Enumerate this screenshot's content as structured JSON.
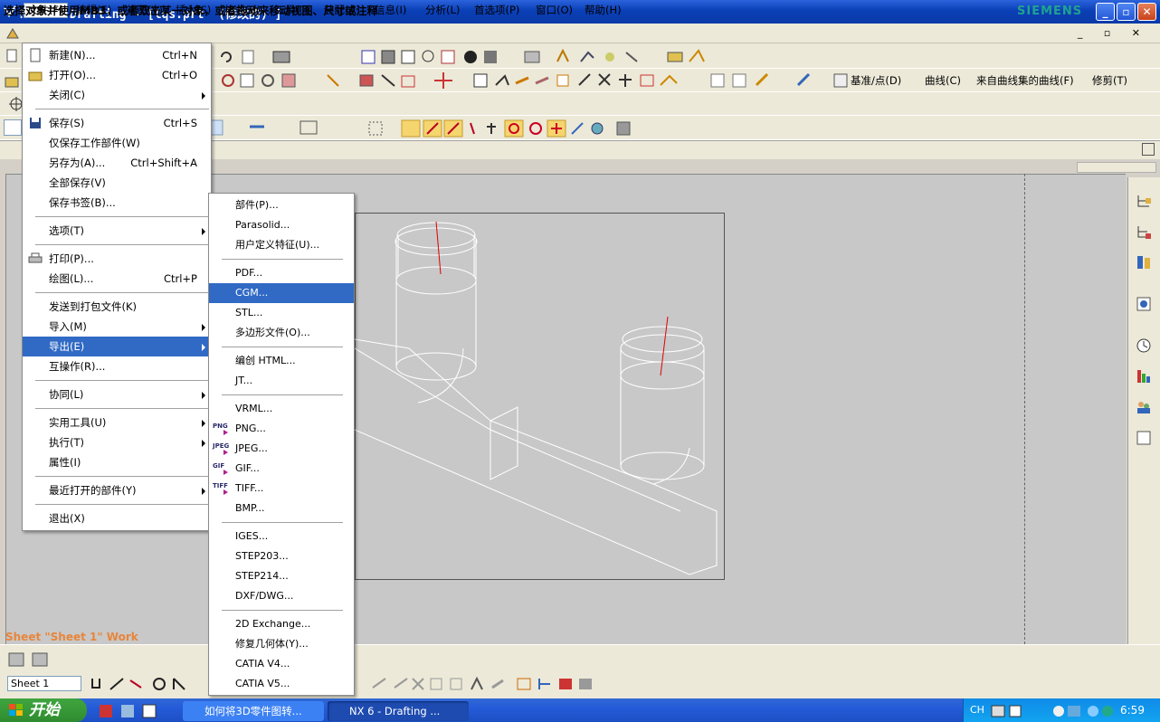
{
  "window": {
    "title": "NX 6 - Drafting - [lqs.prt  (修改的) ]",
    "brand": "SIEMENS"
  },
  "menubar": [
    "文件(F)",
    "编辑(E)",
    "视图(V)",
    "插入(S)",
    "格式(R)",
    "工具(T)",
    "装配(A)",
    "信息(I)",
    "分析(L)",
    "首选项(P)",
    "窗口(O)",
    "帮助(H)"
  ],
  "toolbar3": {
    "snap_label": "基准/点(D)",
    "curve_label": "曲线(C)",
    "curve_collection": "来自曲线集的曲线(F)",
    "trim_label": "修剪(T)"
  },
  "cue_line": "选择对象并使用MB3，或者双击某一对象，或者拖动来移动视图、尺寸或注释",
  "sheet_label": "Sheet \"Sheet 1\" Work",
  "sheet_select": "Sheet 1",
  "file_menu": [
    {
      "label": "新建(N)...",
      "shortcut": "Ctrl+N",
      "icon": "new-file-icon"
    },
    {
      "label": "打开(O)...",
      "shortcut": "Ctrl+O",
      "icon": "open-folder-icon"
    },
    {
      "label": "关闭(C)",
      "submenu": true
    },
    {
      "sep": true
    },
    {
      "label": "保存(S)",
      "shortcut": "Ctrl+S",
      "icon": "save-icon"
    },
    {
      "label": "仅保存工作部件(W)"
    },
    {
      "label": "另存为(A)...",
      "shortcut": "Ctrl+Shift+A"
    },
    {
      "label": "全部保存(V)"
    },
    {
      "label": "保存书签(B)..."
    },
    {
      "sep": true
    },
    {
      "label": "选项(T)",
      "submenu": true
    },
    {
      "sep": true
    },
    {
      "label": "打印(P)...",
      "icon": "printer-icon"
    },
    {
      "label": "绘图(L)...",
      "shortcut": "Ctrl+P"
    },
    {
      "sep": true
    },
    {
      "label": "发送到打包文件(K)"
    },
    {
      "label": "导入(M)",
      "submenu": true
    },
    {
      "label": "导出(E)",
      "submenu": true,
      "highlight": true
    },
    {
      "label": "互操作(R)..."
    },
    {
      "sep": true
    },
    {
      "label": "协同(L)",
      "submenu": true
    },
    {
      "sep": true
    },
    {
      "label": "实用工具(U)",
      "submenu": true
    },
    {
      "label": "执行(T)",
      "submenu": true
    },
    {
      "label": "属性(I)"
    },
    {
      "sep": true
    },
    {
      "label": "最近打开的部件(Y)",
      "submenu": true
    },
    {
      "sep": true
    },
    {
      "label": "退出(X)"
    }
  ],
  "export_menu": [
    {
      "label": "部件(P)..."
    },
    {
      "label": "Parasolid..."
    },
    {
      "label": "用户定义特征(U)..."
    },
    {
      "sep": true
    },
    {
      "label": "PDF..."
    },
    {
      "label": "CGM...",
      "highlight": true
    },
    {
      "label": "STL..."
    },
    {
      "label": "多边形文件(O)..."
    },
    {
      "sep": true
    },
    {
      "label": "编创 HTML..."
    },
    {
      "label": "JT..."
    },
    {
      "sep": true
    },
    {
      "label": "VRML..."
    },
    {
      "label": "PNG...",
      "fmt": "PNG"
    },
    {
      "label": "JPEG...",
      "fmt": "JPEG"
    },
    {
      "label": "GIF...",
      "fmt": "GIF"
    },
    {
      "label": "TIFF...",
      "fmt": "TIFF"
    },
    {
      "label": "BMP..."
    },
    {
      "sep": true
    },
    {
      "label": "IGES..."
    },
    {
      "label": "STEP203..."
    },
    {
      "label": "STEP214..."
    },
    {
      "label": "DXF/DWG..."
    },
    {
      "sep": true
    },
    {
      "label": "2D Exchange..."
    },
    {
      "label": "修复几何体(Y)..."
    },
    {
      "label": "CATIA V4..."
    },
    {
      "label": "CATIA V5..."
    }
  ],
  "taskbar": {
    "start_label": "开始",
    "tasks": [
      "如何将3D零件图转...",
      "NX 6 - Drafting ..."
    ],
    "tray_lang": "CH",
    "clock": "6:59"
  }
}
